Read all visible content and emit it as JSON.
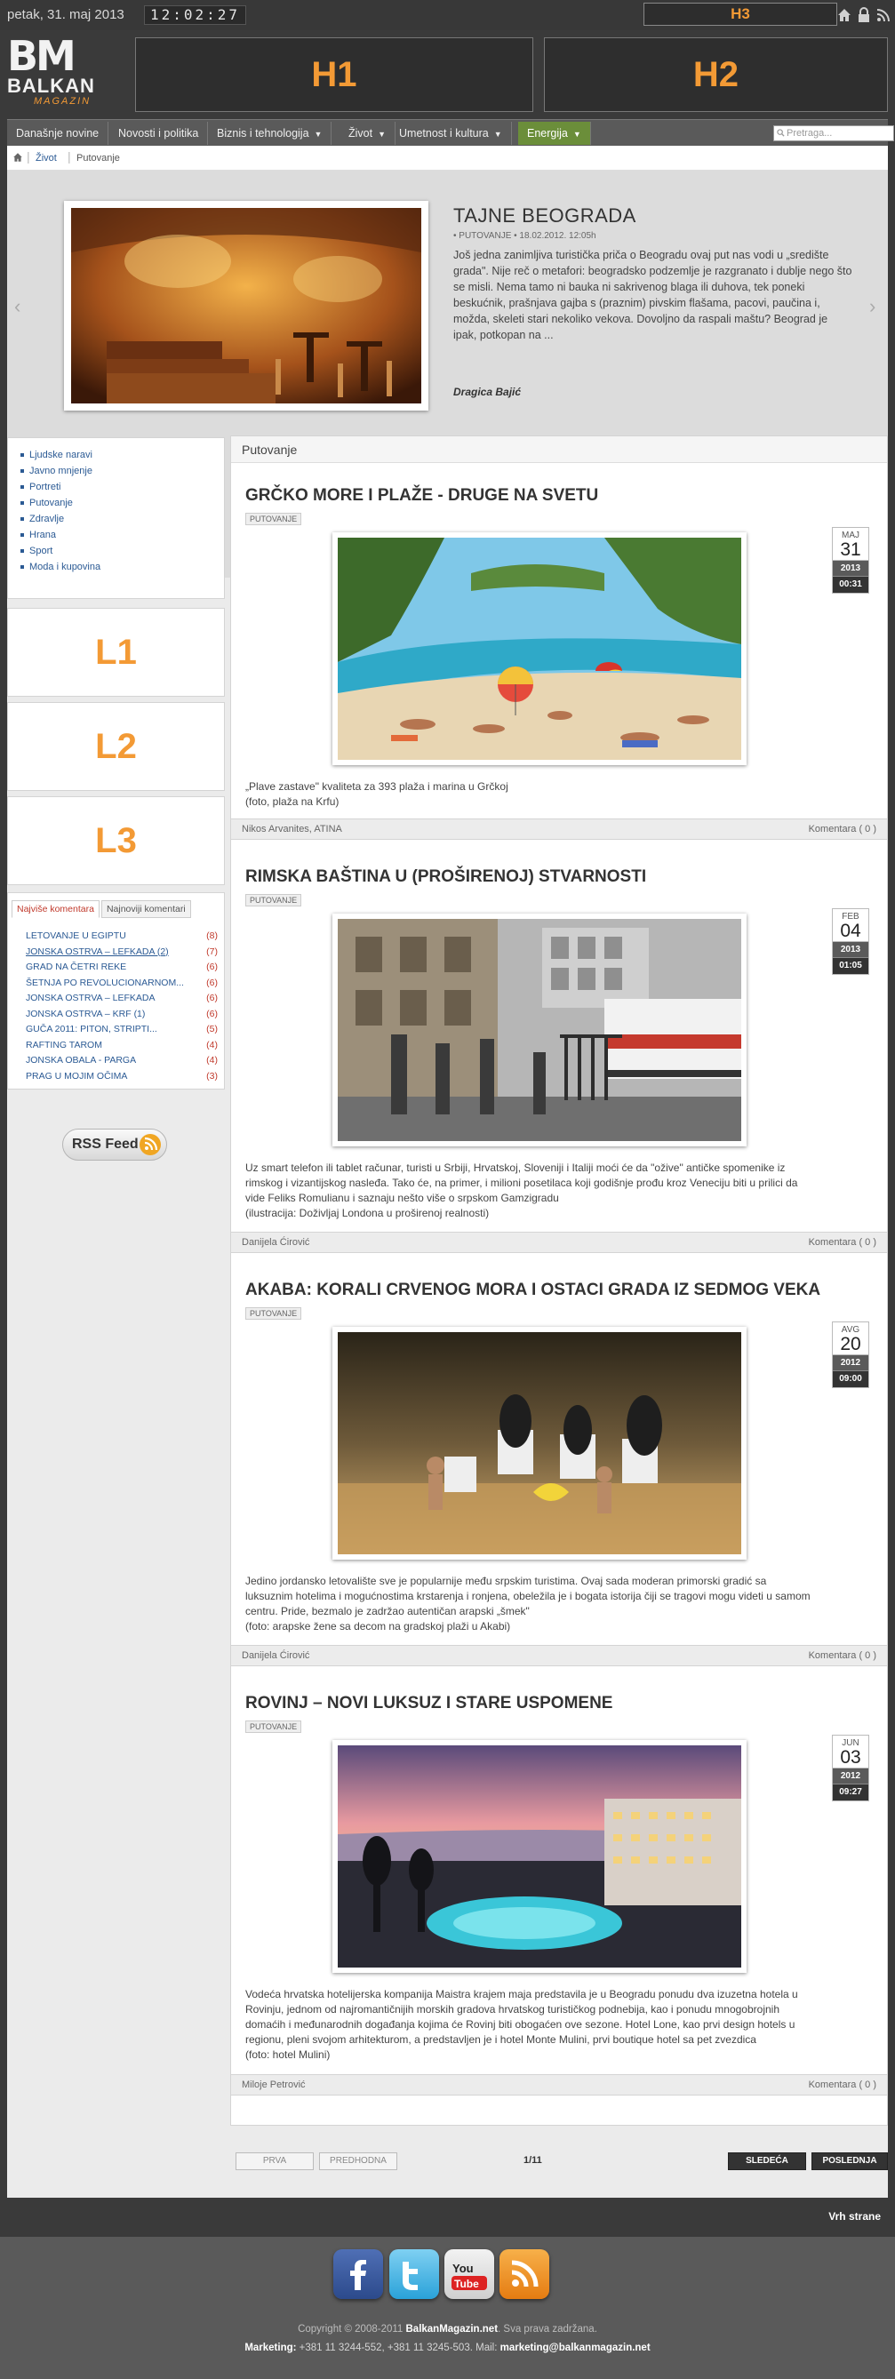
{
  "topbar": {
    "date": "petak, 31. maj 2013",
    "time": "12:02:27",
    "h3_label": "H3",
    "icons": [
      "home-icon",
      "lock-icon",
      "rss-signal-icon"
    ]
  },
  "header": {
    "logo_bm": "BM",
    "logo_balkan": "BALKAN",
    "logo_magazin": "MAGAZIN",
    "h1_label": "H1",
    "h2_label": "H2"
  },
  "nav": {
    "items": [
      {
        "label": "Današnje novine"
      },
      {
        "label": "Novosti i politika"
      },
      {
        "label": "Biznis i tehnologija"
      },
      {
        "label": "Život"
      },
      {
        "label": "Umetnost i kultura"
      },
      {
        "label": "Energija"
      }
    ],
    "search_placeholder": "Pretraga..."
  },
  "breadcrumb": {
    "items": [
      "Život",
      "Putovanje"
    ]
  },
  "featured": {
    "title": "TAJNE BEOGRADA",
    "meta": "• PUTOVANJE • 18.02.2012. 12:05h",
    "text": "Još jedna zanimljiva turistička priča o Beogradu ovaj put nas vodi u „središte grada\". Nije reč o metafori: beogradsko podzemlje je razgranato i dublje nego što se misli. Nema tamo ni bauka ni sakrivenog blaga ili duhova, tek poneki beskućnik, prašnjava gajba s (praznim) pivskim flašama, pacovi, paučina i, možda, skeleti stari nekoliko vekova. Dovoljno da raspali maštu? Beograd je ipak, potkopan na ...",
    "author": "Dragica Bajić",
    "slide_count": 5,
    "active_slide": 1
  },
  "sidebar": {
    "categories": [
      "Ljudske naravi",
      "Javno mnjenje",
      "Portreti",
      "Putovanje",
      "Zdravlje",
      "Hrana",
      "Sport",
      "Moda i kupovina"
    ],
    "ads": [
      "L1",
      "L2",
      "L3"
    ],
    "tabs": [
      "Najviše komentara",
      "Najnoviji komentari"
    ],
    "comments": [
      {
        "title": "LETOVANJE U EGIPTU",
        "count": "(8)"
      },
      {
        "title": "JONSKA OSTRVA – LEFKADA (2)",
        "count": "(7)"
      },
      {
        "title": "GRAD NA ČETRI REKE",
        "count": "(6)"
      },
      {
        "title": "ŠETNJA PO REVOLUCIONARNOM...",
        "count": "(6)"
      },
      {
        "title": "JONSKA OSTRVA – LEFKADA",
        "count": "(6)"
      },
      {
        "title": "JONSKA OSTRVA – KRF (1)",
        "count": "(6)"
      },
      {
        "title": "GUČA 2011: PITON, STRIPTI...",
        "count": "(5)"
      },
      {
        "title": "RAFTING TAROM",
        "count": "(4)"
      },
      {
        "title": "JONSKA OBALA - PARGA",
        "count": "(4)"
      },
      {
        "title": "PRAG U MOJIM OČIMA",
        "count": "(3)"
      }
    ],
    "rss_label": "RSS Feed"
  },
  "content": {
    "section_title": "Putovanje",
    "articles": [
      {
        "title": "GRČKO MORE I PLAŽE - DRUGE NA SVETU",
        "tag": "PUTOVANJE",
        "month": "MAJ",
        "day": "31",
        "year": "2013",
        "time": "00:31",
        "text": "„Plave zastave\" kvaliteta za 393 plaža i marina u Grčkoj\n(foto, plaža na Krfu)",
        "author": "Nikos Arvanites, ATINA",
        "comments": "Komentara ( 0 )"
      },
      {
        "title": "RIMSKA BAŠTINA U (PROŠIRENOJ) STVARNOSTI",
        "tag": "PUTOVANJE",
        "month": "FEB",
        "day": "04",
        "year": "2013",
        "time": "01:05",
        "text": "Uz smart telefon ili tablet računar, turisti u Srbiji, Hrvatskoj, Sloveniji i Italiji moći će da \"ožive\" antičke spomenike iz rimskog i vizantijskog nasleđa. Tako će, na primer, i milioni posetilaca koji godišnje prođu kroz Veneciju biti u prilici da vide Feliks Romulianu i saznaju nešto više o srpskom Gamzigradu\n(ilustracija: Doživljaj Londona u proširenoj realnosti)",
        "author": "Danijela Ćirović",
        "comments": "Komentara ( 0 )"
      },
      {
        "title": "AKABA: KORALI CRVENOG MORA I OSTACI GRADA IZ SEDMOG VEKA",
        "tag": "PUTOVANJE",
        "month": "AVG",
        "day": "20",
        "year": "2012",
        "time": "09:00",
        "text": "Jedino jordansko letovalište sve je popularnije među srpskim turistima. Ovaj sada moderan primorski gradić sa luksuznim hotelima i mogućnostima krstarenja i ronjena, obeležila je i bogata istorija čiji se tragovi mogu videti u samom centru. Pride, bezmalo je zadržao autentičan arapski „šmek\"\n(foto: arapske žene sa decom na gradskoj plaži u Akabi)",
        "author": "Danijela Ćirović",
        "comments": "Komentara ( 0 )"
      },
      {
        "title": "ROVINJ – NOVI LUKSUZ I STARE USPOMENE",
        "tag": "PUTOVANJE",
        "month": "JUN",
        "day": "03",
        "year": "2012",
        "time": "09:27",
        "text": "Vodeća hrvatska hotelijerska kompanija Maistra krajem maja predstavila je u Beogradu ponudu dva izuzetna hotela u Rovinju, jednom od najromantičnijih morskih gradova hrvatskog turističkog podnebija, kao i ponudu mnogobrojnih domaćih i međunarodnih događanja kojima će Rovinj biti obogaćen ove sezone. Hotel Lone, kao prvi design hotels u regionu, pleni svojom arhitekturom, a predstavljen je i hotel Monte Mulini, prvi boutique hotel sa pet zvezdica\n(foto: hotel Mulini)",
        "author": "Miloje Petrović",
        "comments": "Komentara ( 0 )"
      }
    ]
  },
  "pager": {
    "first": "PRVA",
    "prev": "PREDHODNA",
    "page": "1/11",
    "next": "SLEDEĆA",
    "last": "POSLEDNJA"
  },
  "footer": {
    "back_to_top": "Vrh strane",
    "social": [
      "facebook-icon",
      "twitter-icon",
      "youtube-icon",
      "rss-icon"
    ],
    "copyright_pre": "Copyright © 2008-2011 ",
    "copyright_site": "BalkanMagazin.net",
    "copyright_post": ". Sva prava zadržana.",
    "marketing_label": "Marketing:",
    "marketing_phones": " +381 11 3244-552, +381 11 3245-503. ",
    "mail_label": "Mail: ",
    "mail": "marketing@balkanmagazin.net"
  },
  "colors": {
    "accent_orange": "#f39a35",
    "nav_active_green": "#6b8e3a",
    "link_blue": "#2b5a94",
    "comment_count_red": "#c0392b",
    "slider_dot_active": "#3b8fd8"
  }
}
